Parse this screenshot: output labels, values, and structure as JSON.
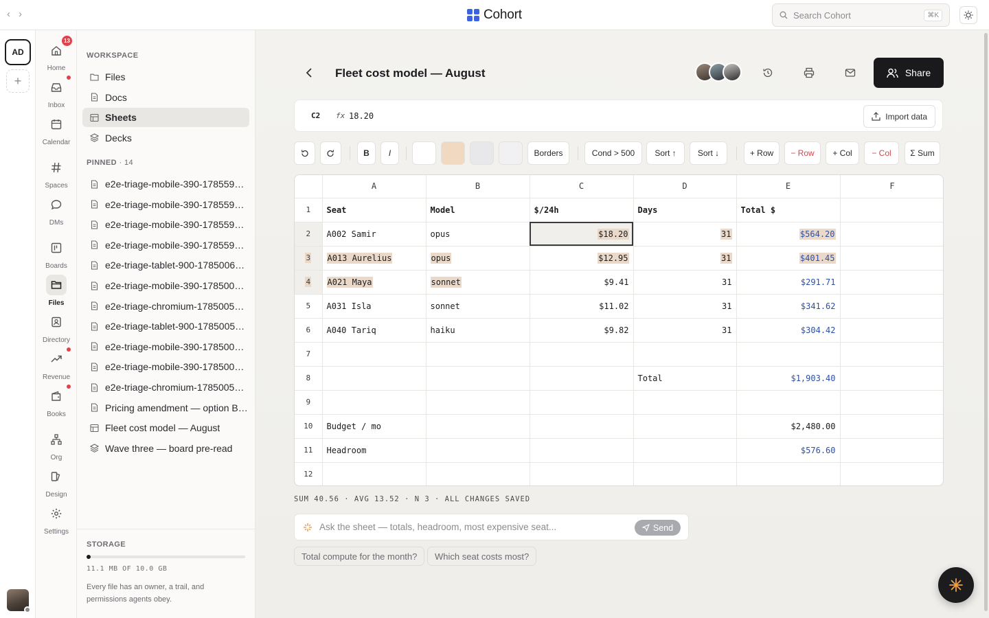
{
  "app": {
    "name": "Cohort"
  },
  "search": {
    "placeholder": "Search Cohort",
    "shortcut": "⌘K"
  },
  "workspace": {
    "initials": "AD"
  },
  "nav": [
    {
      "label": "Home",
      "icon": "home-icon",
      "badge": "13"
    },
    {
      "label": "Inbox",
      "icon": "inbox-icon",
      "dot": true
    },
    {
      "label": "Calendar",
      "icon": "calendar-icon"
    },
    {
      "label": "Spaces",
      "icon": "hash-icon"
    },
    {
      "label": "DMs",
      "icon": "chat-icon"
    },
    {
      "label": "Boards",
      "icon": "board-icon"
    },
    {
      "label": "Files",
      "icon": "folder-icon",
      "active": true
    },
    {
      "label": "Directory",
      "icon": "contact-icon"
    },
    {
      "label": "Revenue",
      "icon": "trend-icon",
      "dot": true
    },
    {
      "label": "Books",
      "icon": "wallet-icon",
      "dot": true
    },
    {
      "label": "Org",
      "icon": "org-icon"
    },
    {
      "label": "Design",
      "icon": "design-icon"
    },
    {
      "label": "Settings",
      "icon": "gear-icon"
    }
  ],
  "sidebar": {
    "workspace_heading": "WORKSPACE",
    "workspace_items": [
      {
        "label": "Files",
        "icon": "folder-icon"
      },
      {
        "label": "Docs",
        "icon": "doc-icon"
      },
      {
        "label": "Sheets",
        "icon": "sheet-icon",
        "active": true
      },
      {
        "label": "Decks",
        "icon": "layers-icon"
      }
    ],
    "pinned_heading": "PINNED",
    "pinned_count": "· 14",
    "pinned_items": [
      {
        "label": "e2e-triage-mobile-390-1785594…",
        "icon": "doc-icon"
      },
      {
        "label": "e2e-triage-mobile-390-1785594…",
        "icon": "doc-icon"
      },
      {
        "label": "e2e-triage-mobile-390-1785594…",
        "icon": "doc-icon"
      },
      {
        "label": "e2e-triage-mobile-390-1785594…",
        "icon": "doc-icon"
      },
      {
        "label": "e2e-triage-tablet-900-1785006…",
        "icon": "doc-icon"
      },
      {
        "label": "e2e-triage-mobile-390-178500…",
        "icon": "doc-icon"
      },
      {
        "label": "e2e-triage-chromium-1785005…",
        "icon": "doc-icon"
      },
      {
        "label": "e2e-triage-tablet-900-1785005…",
        "icon": "doc-icon"
      },
      {
        "label": "e2e-triage-mobile-390-178500…",
        "icon": "doc-icon"
      },
      {
        "label": "e2e-triage-mobile-390-178500…",
        "icon": "doc-icon"
      },
      {
        "label": "e2e-triage-chromium-17850051…",
        "icon": "doc-icon"
      },
      {
        "label": "Pricing amendment — option B …",
        "icon": "doc-icon"
      },
      {
        "label": "Fleet cost model — August",
        "icon": "sheet-icon"
      },
      {
        "label": "Wave three — board pre-read",
        "icon": "layers-icon"
      }
    ],
    "storage": {
      "heading": "STORAGE",
      "used": "11.1 MB OF 10.0 GB",
      "fraction": 0.001,
      "note": "Every file has an owner, a trail, and permissions agents obey."
    }
  },
  "document": {
    "title": "Fleet cost model — August",
    "share_label": "Share"
  },
  "formula": {
    "cell": "C2",
    "fx": "fx",
    "value": "18.20",
    "import_label": "Import data"
  },
  "toolbar": {
    "bold": "B",
    "italic": "I",
    "borders": "Borders",
    "cond": "Cond > 500",
    "sort_asc": "Sort ↑",
    "sort_desc": "Sort ↓",
    "add_row": "+ Row",
    "del_row": "− Row",
    "add_col": "+ Col",
    "del_col": "− Col",
    "sum": "Σ Sum",
    "swatches": [
      "#ffffff",
      "#f0d9c0",
      "#e8e8ea",
      "#f1f1f3"
    ]
  },
  "sheet": {
    "columns": [
      "A",
      "B",
      "C",
      "D",
      "E",
      "F"
    ],
    "rows": [
      {
        "n": "1",
        "cells": [
          "Seat",
          "Model",
          "$/24h",
          "Days",
          "Total $",
          ""
        ]
      },
      {
        "n": "2",
        "cells": [
          "A002 Samir",
          "opus",
          "$18.20",
          "31",
          "$564.20",
          ""
        ]
      },
      {
        "n": "3",
        "cells": [
          "A013 Aurelius",
          "opus",
          "$12.95",
          "31",
          "$401.45",
          ""
        ]
      },
      {
        "n": "4",
        "cells": [
          "A021 Maya",
          "sonnet",
          "$9.41",
          "31",
          "$291.71",
          ""
        ]
      },
      {
        "n": "5",
        "cells": [
          "A031 Isla",
          "sonnet",
          "$11.02",
          "31",
          "$341.62",
          ""
        ]
      },
      {
        "n": "6",
        "cells": [
          "A040 Tariq",
          "haiku",
          "$9.82",
          "31",
          "$304.42",
          ""
        ]
      },
      {
        "n": "7",
        "cells": [
          "",
          "",
          "",
          "",
          "",
          ""
        ]
      },
      {
        "n": "8",
        "cells": [
          "",
          "",
          "",
          "Total",
          "$1,903.40",
          ""
        ]
      },
      {
        "n": "9",
        "cells": [
          "",
          "",
          "",
          "",
          "",
          ""
        ]
      },
      {
        "n": "10",
        "cells": [
          "Budget / mo",
          "",
          "",
          "",
          "$2,480.00",
          ""
        ]
      },
      {
        "n": "11",
        "cells": [
          "Headroom",
          "",
          "",
          "",
          "$576.60",
          ""
        ]
      },
      {
        "n": "12",
        "cells": [
          "",
          "",
          "",
          "",
          "",
          ""
        ]
      }
    ]
  },
  "status": "SUM 40.56 · AVG 13.52 · N 3 · ALL CHANGES SAVED",
  "ask": {
    "placeholder": "Ask the sheet — totals, headroom, most expensive seat...",
    "send_label": "Send"
  },
  "suggestions": [
    "Total compute for the month?",
    "Which seat costs most?"
  ]
}
